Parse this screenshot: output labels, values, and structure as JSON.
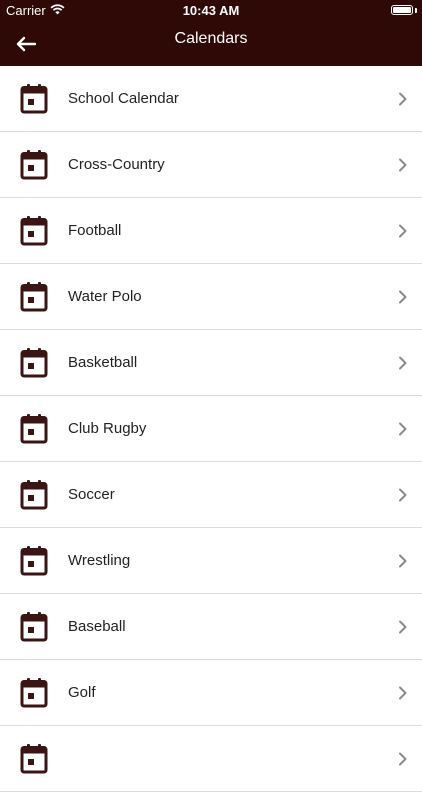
{
  "status_bar": {
    "carrier": "Carrier",
    "time": "10:43 AM",
    "battery_level": 1.0
  },
  "nav": {
    "title": "Calendars",
    "back_icon": "back-arrow-icon"
  },
  "list": {
    "items": [
      {
        "label": "School Calendar",
        "icon": "calendar-icon"
      },
      {
        "label": "Cross-Country",
        "icon": "calendar-icon"
      },
      {
        "label": "Football",
        "icon": "calendar-icon"
      },
      {
        "label": "Water Polo",
        "icon": "calendar-icon"
      },
      {
        "label": "Basketball",
        "icon": "calendar-icon"
      },
      {
        "label": "Club Rugby",
        "icon": "calendar-icon"
      },
      {
        "label": "Soccer",
        "icon": "calendar-icon"
      },
      {
        "label": "Wrestling",
        "icon": "calendar-icon"
      },
      {
        "label": "Baseball",
        "icon": "calendar-icon"
      },
      {
        "label": "Golf",
        "icon": "calendar-icon"
      },
      {
        "label": "",
        "icon": "calendar-icon"
      }
    ]
  },
  "colors": {
    "header_bg": "#2f0906",
    "icon": "#3a1514",
    "divider": "#dcdcdc",
    "chevron": "#8a8a8a"
  }
}
